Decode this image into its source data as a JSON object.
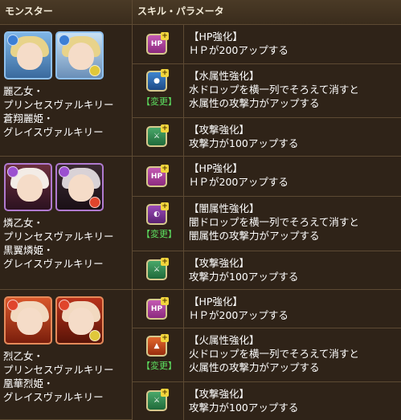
{
  "header": {
    "col_monster": "モンスター",
    "col_skill": "スキル・パラメータ"
  },
  "monsters": [
    {
      "lines": [
        "麗乙女・",
        "プリンセスヴァルキリー",
        "蒼翔麗姫・",
        "グレイスヴァルキリー"
      ],
      "main_attr_color": "#3b7fd6",
      "sub_attr_color": "#e0c83a",
      "theme": [
        "#7fb6e6",
        "#c9e2f5",
        "#e8d38a"
      ]
    },
    {
      "lines": [
        "燐乙女・",
        "プリンセスヴァルキリー",
        "黒翼燐姫・",
        "グレイスヴァルキリー"
      ],
      "main_attr_color": "#9b4fd0",
      "sub_attr_color": "#e0452c",
      "theme": [
        "#6b2f3e",
        "#f3ece6",
        "#d9d2d6"
      ]
    },
    {
      "lines": [
        "烈乙女・",
        "プリンセスヴァルキリー",
        "凰華烈姫・",
        "グレイスヴァルキリー"
      ],
      "main_attr_color": "#e0452c",
      "sub_attr_color": "#e0c83a",
      "theme": [
        "#d8572b",
        "#f2d9c0",
        "#e6b43a"
      ]
    }
  ],
  "skills": [
    {
      "icon": "hp-up-icon",
      "henkou": "",
      "title": "【HP強化】",
      "desc": [
        "ＨＰが200アップする"
      ]
    },
    {
      "icon": "water-attr-up-icon",
      "henkou": "【変更】",
      "title": "【水属性強化】",
      "desc": [
        "水ドロップを横一列でそろえて消すと",
        "水属性の攻撃力がアップする"
      ]
    },
    {
      "icon": "attack-up-icon",
      "henkou": "",
      "title": "【攻撃強化】",
      "desc": [
        "攻撃力が100アップする"
      ]
    },
    {
      "icon": "hp-up-icon",
      "henkou": "",
      "title": "【HP強化】",
      "desc": [
        "ＨＰが200アップする"
      ]
    },
    {
      "icon": "dark-attr-up-icon",
      "henkou": "【変更】",
      "title": "【闇属性強化】",
      "desc": [
        "闇ドロップを横一列でそろえて消すと",
        "闇属性の攻撃力がアップする"
      ]
    },
    {
      "icon": "attack-up-icon",
      "henkou": "",
      "title": "【攻撃強化】",
      "desc": [
        "攻撃力が100アップする"
      ]
    },
    {
      "icon": "hp-up-icon",
      "henkou": "",
      "title": "【HP強化】",
      "desc": [
        "ＨＰが200アップする"
      ]
    },
    {
      "icon": "fire-attr-up-icon",
      "henkou": "【変更】",
      "title": "【火属性強化】",
      "desc": [
        "火ドロップを横一列でそろえて消すと",
        "火属性の攻撃力がアップする"
      ]
    },
    {
      "icon": "attack-up-icon",
      "henkou": "",
      "title": "【攻撃強化】",
      "desc": [
        "攻撃力が100アップする"
      ]
    }
  ]
}
